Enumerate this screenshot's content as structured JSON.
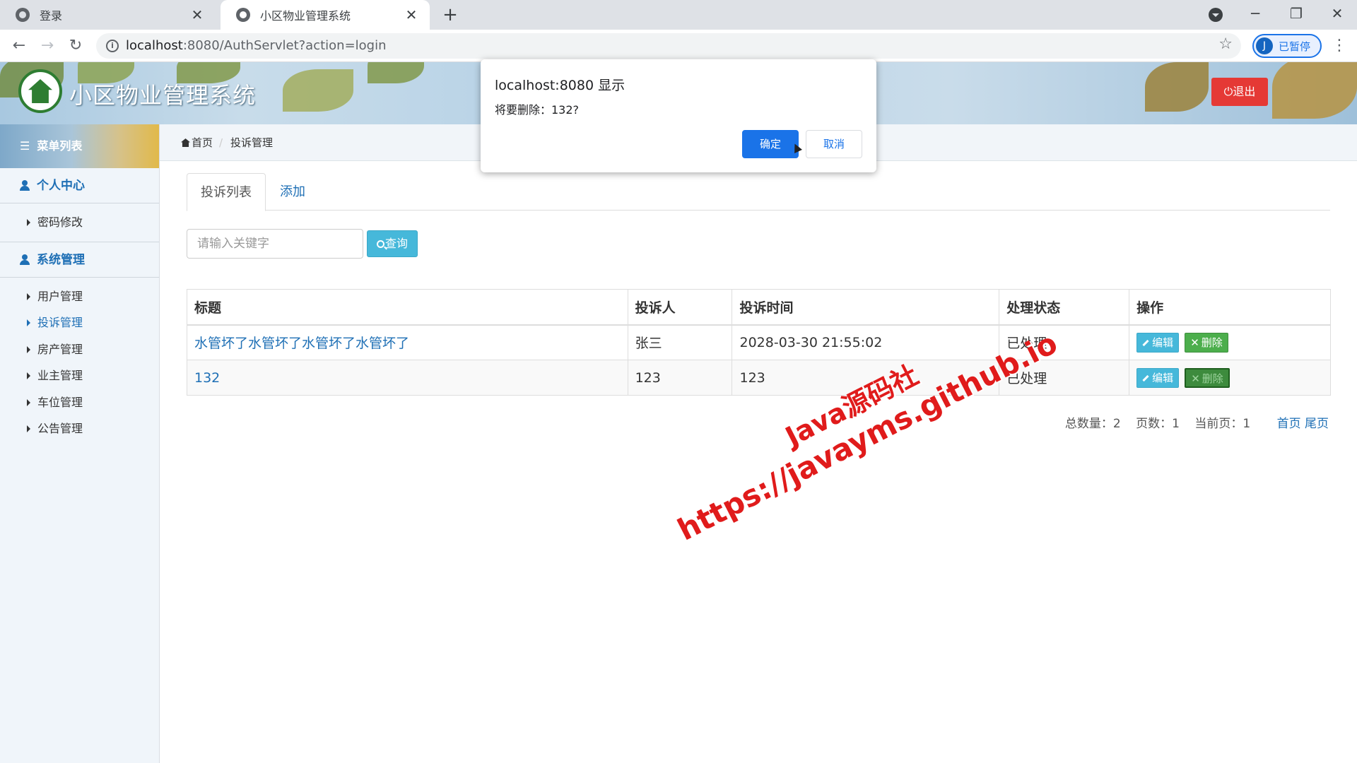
{
  "browser": {
    "tabs": [
      {
        "title": "登录",
        "close": "✕"
      },
      {
        "title": "小区物业管理系统",
        "close": "✕"
      }
    ],
    "new_tab": "+",
    "url_host": "localhost",
    "url_path": ":8080/AuthServlet?action=login",
    "profile_initial": "J",
    "profile_status": "已暂停"
  },
  "header": {
    "site_title": "小区物业管理系统",
    "logout_label": "⏻退出"
  },
  "sidebar": {
    "menu_title": "菜单列表",
    "groups": [
      {
        "label": "个人中心",
        "items": [
          {
            "label": "密码修改"
          }
        ]
      },
      {
        "label": "系统管理",
        "items": [
          {
            "label": "用户管理"
          },
          {
            "label": "投诉管理"
          },
          {
            "label": "房产管理"
          },
          {
            "label": "业主管理"
          },
          {
            "label": "车位管理"
          },
          {
            "label": "公告管理"
          }
        ]
      }
    ]
  },
  "breadcrumb": {
    "home": "首页",
    "current": "投诉管理",
    "separator": "/"
  },
  "main": {
    "tabs": [
      {
        "label": "投诉列表"
      },
      {
        "label": "添加"
      }
    ],
    "search": {
      "placeholder": "请输入关键字",
      "button_label": "查询"
    },
    "table": {
      "columns": [
        "标题",
        "投诉人",
        "投诉时间",
        "处理状态",
        "操作"
      ],
      "rows": [
        {
          "title": "水管坏了水管坏了水管坏了水管坏了",
          "person": "张三",
          "time": "2028-03-30 21:55:02",
          "status": "已处理"
        },
        {
          "title": "132",
          "person": "123",
          "time": "123",
          "status": "已处理"
        }
      ],
      "edit_label": "编辑",
      "delete_label": "删除"
    },
    "pager": {
      "total": "总数量：2",
      "pages": "页数：1",
      "current": "当前页：1",
      "first": "首页",
      "last": "尾页"
    }
  },
  "dialog": {
    "title": "localhost:8080 显示",
    "message": "将要删除：132?",
    "ok_label": "确定",
    "cancel_label": "取消"
  },
  "watermark": {
    "line1": "Java源码社",
    "line2": "https://javayms.github.io"
  },
  "colors": {
    "primary": "#1e6fb5",
    "edit_button": "#46b8da",
    "delete_button": "#4cae4c",
    "logout_button": "#e53935",
    "dialog_ok": "#1a73e8",
    "watermark": "#e01b1b"
  }
}
